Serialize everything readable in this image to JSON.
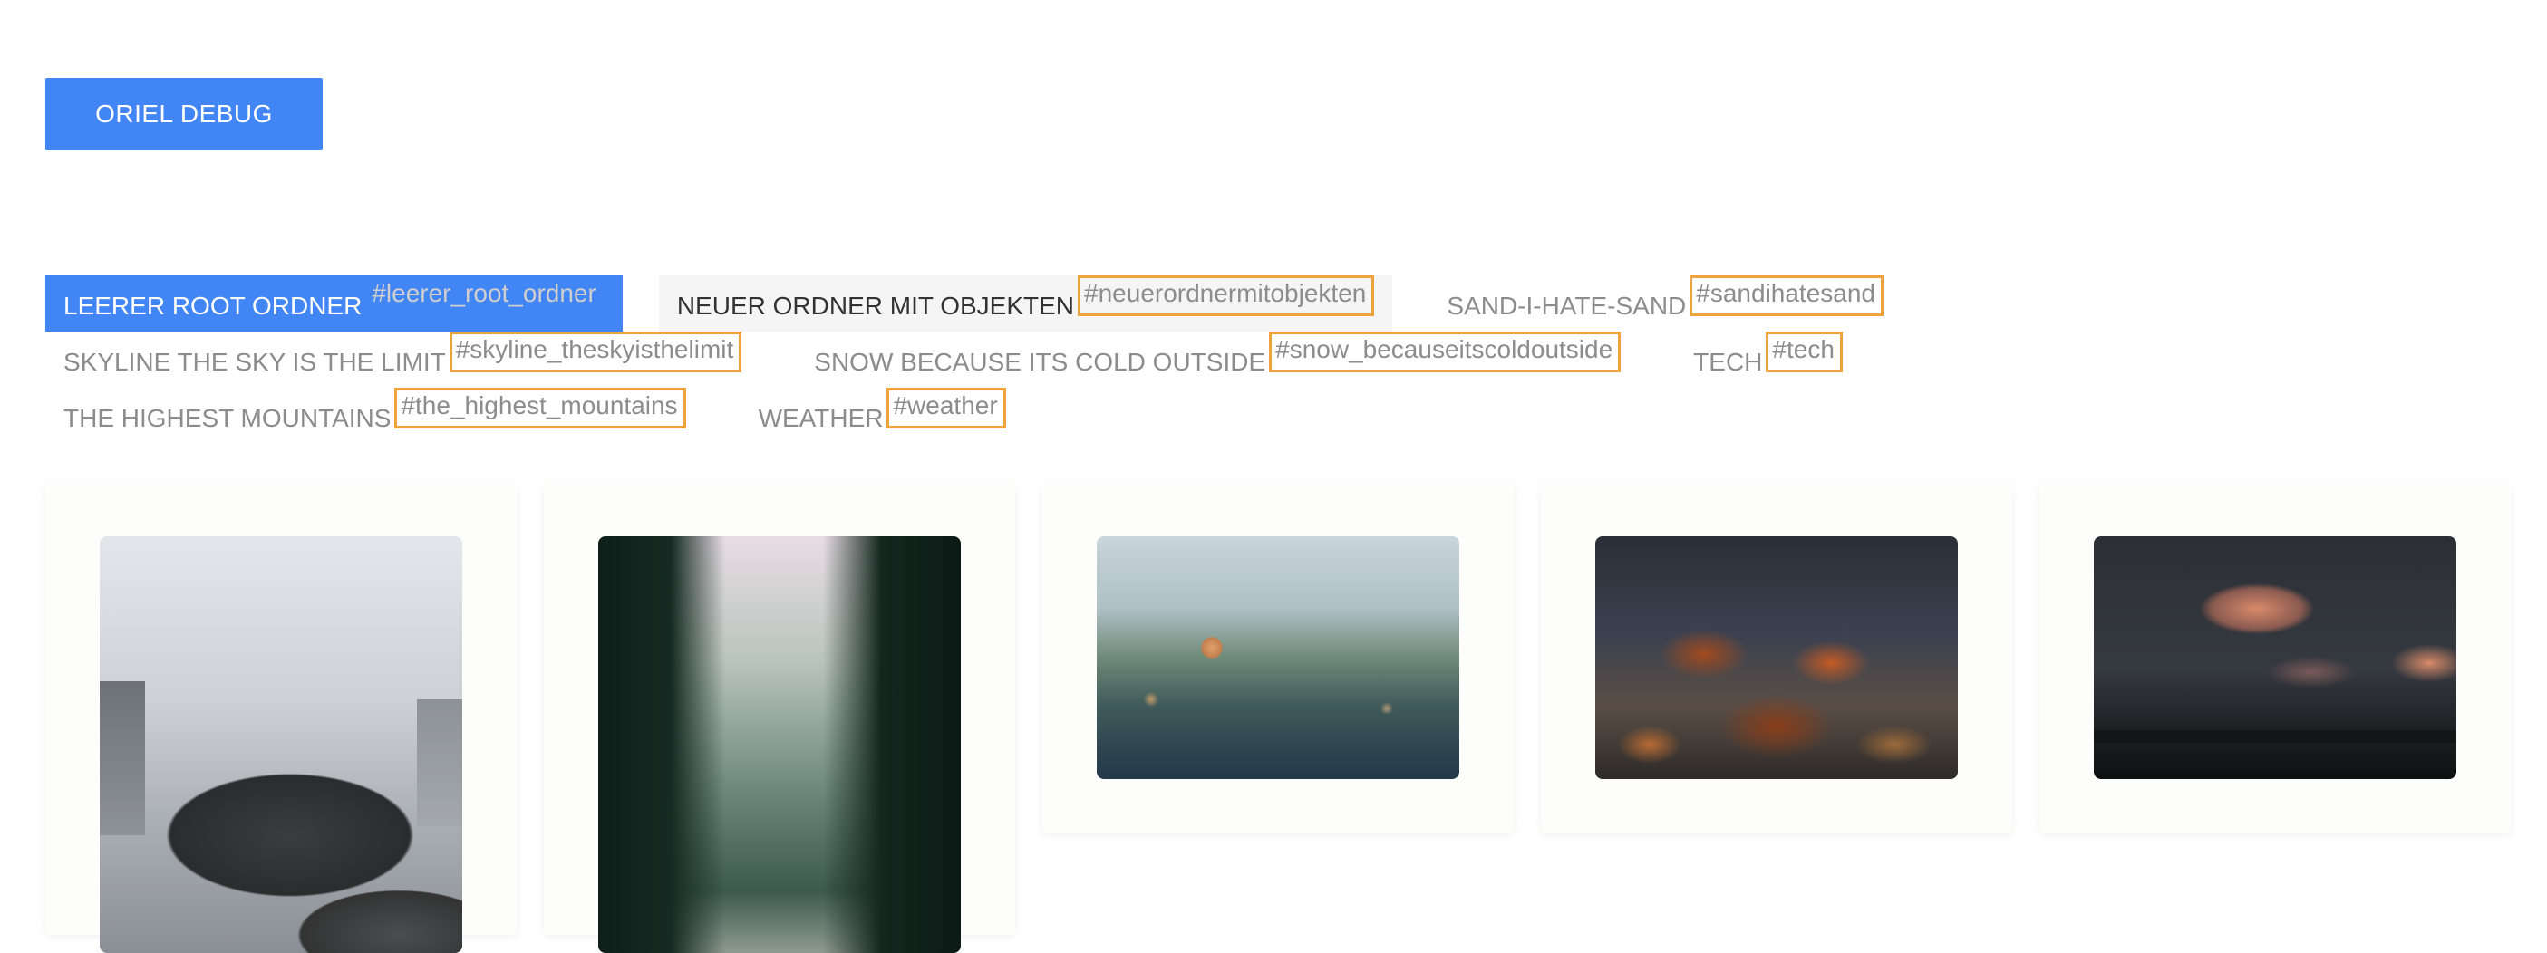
{
  "debug_button": {
    "label": "ORIEL DEBUG"
  },
  "folders": [
    {
      "name": "LEERER ROOT ORDNER",
      "tag": "#leerer_root_ordner",
      "state": "active"
    },
    {
      "name": "NEUER ORDNER MIT OBJEKTEN",
      "tag": "#neuerordnermitobjekten",
      "state": "hover"
    },
    {
      "name": "SAND-I-HATE-SAND",
      "tag": "#sandihatesand",
      "state": "normal"
    },
    {
      "name": "SKYLINE THE SKY IS THE LIMIT",
      "tag": "#skyline_theskyisthelimit",
      "state": "normal"
    },
    {
      "name": "SNOW BECAUSE ITS COLD OUTSIDE",
      "tag": "#snow_becauseitscoldoutside",
      "state": "normal"
    },
    {
      "name": "TECH",
      "tag": "#tech",
      "state": "normal"
    },
    {
      "name": "THE HIGHEST MOUNTAINS",
      "tag": "#the_highest_mountains",
      "state": "normal"
    },
    {
      "name": "WEATHER",
      "tag": "#weather",
      "state": "normal"
    }
  ],
  "colors": {
    "accent": "#4285f4",
    "tag_outline": "#f0a23c",
    "text_muted": "#8c8c8c"
  },
  "images": [
    {
      "icon": "umbrella-rain-photo"
    },
    {
      "icon": "foggy-forest-photo"
    },
    {
      "icon": "rain-window-photo"
    },
    {
      "icon": "autumn-leaves-water-photo"
    },
    {
      "icon": "sunset-clouds-photo"
    }
  ]
}
